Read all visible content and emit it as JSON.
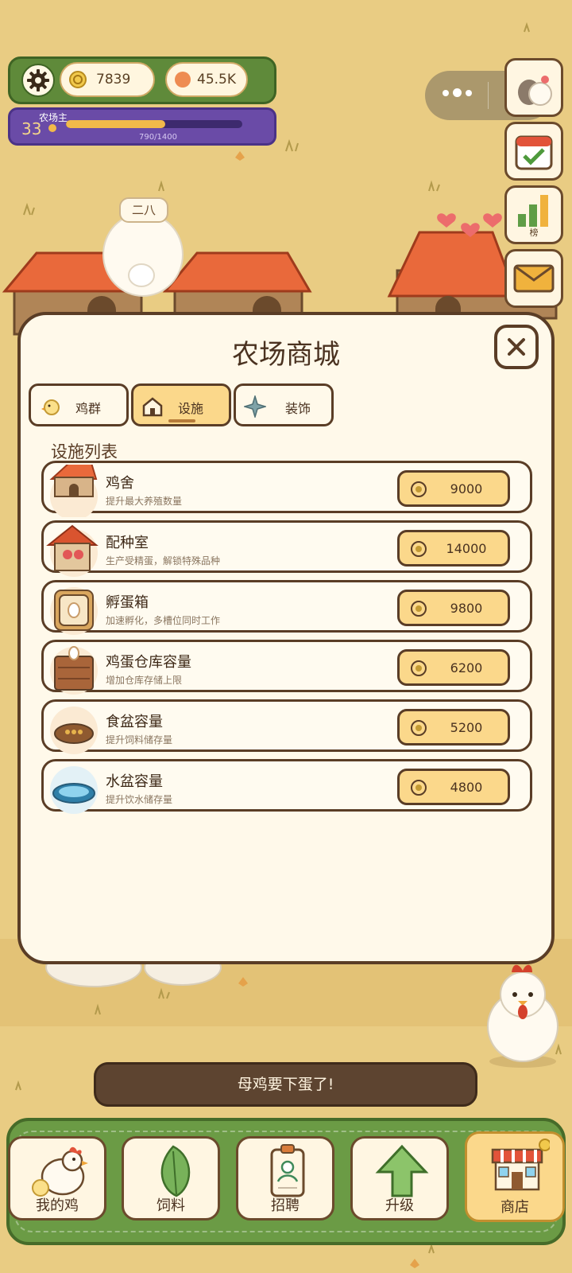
{
  "hud": {
    "coins": "7839",
    "gems": "45.5K",
    "level": "33",
    "level_title": "农场主",
    "xp_text": "790/1400",
    "xp_progress": 0.564
  },
  "side_buttons": {
    "ranking_label": "榜"
  },
  "floating_tag": "二八",
  "shop": {
    "title": "农场商城",
    "tabs": [
      {
        "label": "鸡群",
        "active": false
      },
      {
        "label": "设施",
        "active": true
      },
      {
        "label": "装饰",
        "active": false
      }
    ],
    "section_title": "设施列表",
    "items": [
      {
        "name": "鸡舍",
        "desc": "提升最大养殖数量",
        "price": "9000",
        "icon": "coop-icon"
      },
      {
        "name": "配种室",
        "desc": "生产受精蛋，解锁特殊品种",
        "price": "14000",
        "icon": "breeding-house-icon"
      },
      {
        "name": "孵蛋箱",
        "desc": "加速孵化，多槽位同时工作",
        "price": "9800",
        "icon": "incubator-icon"
      },
      {
        "name": "鸡蛋仓库容量",
        "desc": "增加仓库存储上限",
        "price": "6200",
        "icon": "egg-crate-icon"
      },
      {
        "name": "食盆容量",
        "desc": "提升饲料储存量",
        "price": "5200",
        "icon": "food-bowl-icon"
      },
      {
        "name": "水盆容量",
        "desc": "提升饮水储存量",
        "price": "4800",
        "icon": "water-bowl-icon"
      }
    ]
  },
  "toast": "母鸡要下蛋了!",
  "nav": [
    {
      "label": "我的鸡",
      "icon": "chicken-icon"
    },
    {
      "label": "饲料",
      "icon": "leaf-icon"
    },
    {
      "label": "招聘",
      "icon": "id-badge-icon"
    },
    {
      "label": "升级",
      "icon": "up-arrow-icon"
    },
    {
      "label": "商店",
      "icon": "shop-icon"
    }
  ],
  "colors": {
    "background": "#e9cc83",
    "hud_green": "#5f8a3a",
    "level_purple": "#6a4ba7",
    "button_yellow": "#fbd88b",
    "outline_brown": "#5a3d26",
    "roof_orange": "#e9693b"
  }
}
